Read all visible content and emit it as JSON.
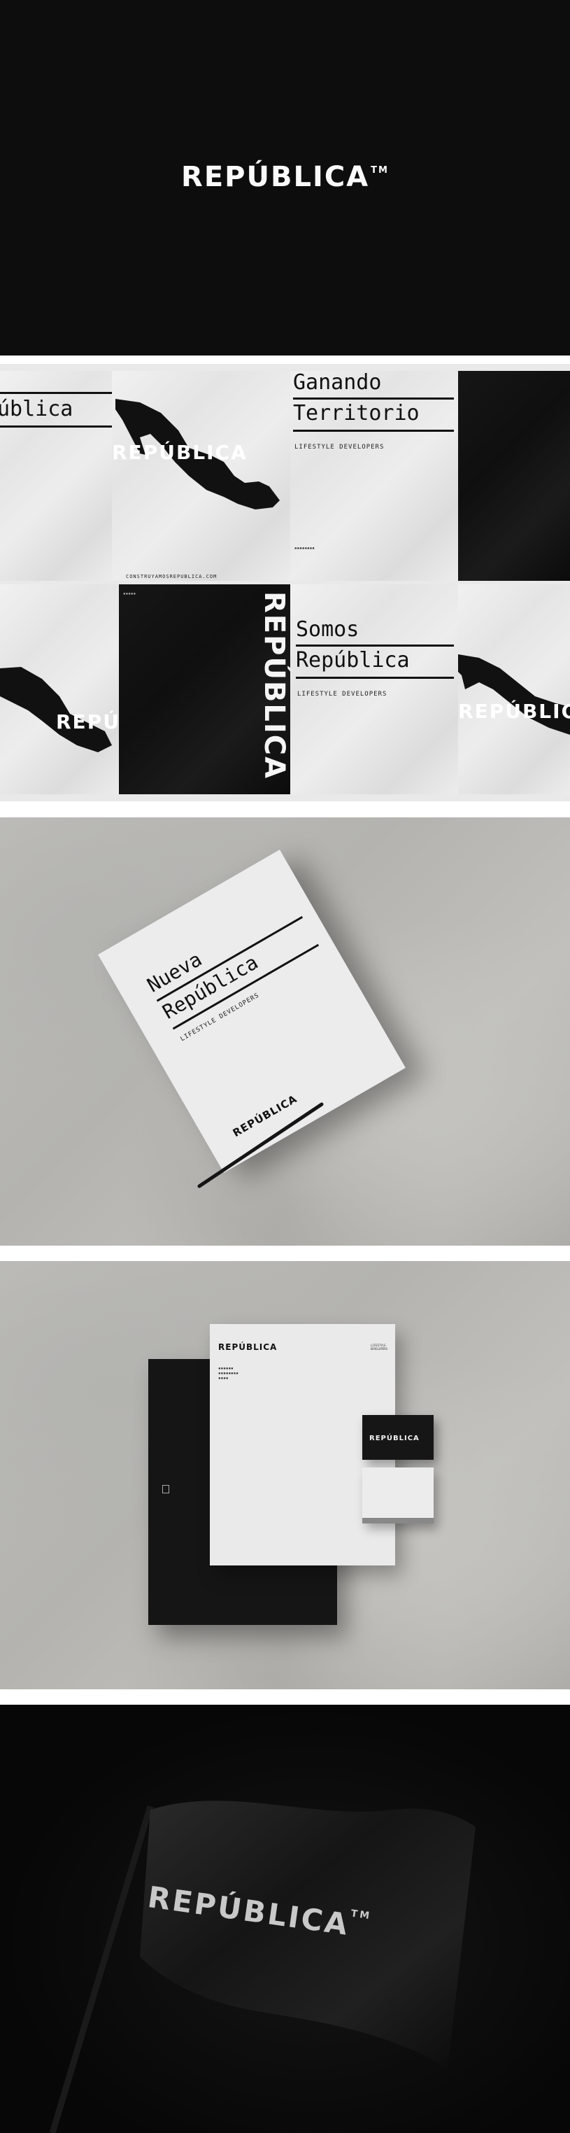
{
  "brand": {
    "name": "REPÚBLICA",
    "trademark": "TM",
    "name_vertical": "REPÚBLICA"
  },
  "posters": {
    "headline_1_line1": "Ganando",
    "headline_1_line2": "Territorio",
    "headline_2_line1": "Somos",
    "headline_2_line2": "República",
    "partial_title": "ública",
    "tagline": "LIFESTYLE DEVELOPERS",
    "website": "CONSTRUYAMOSREPUBLICA.COM"
  },
  "letterhead": {
    "title_line1": "Nueva",
    "title_line2": "República",
    "tagline": "LIFESTYLE DEVELOPERS"
  },
  "stationery": {
    "tagline": "LIFESTYLE DEVELOPERS"
  },
  "colors": {
    "black": "#0d0d0d",
    "white": "#f2f2f2",
    "concrete": "#b8b7b3"
  }
}
